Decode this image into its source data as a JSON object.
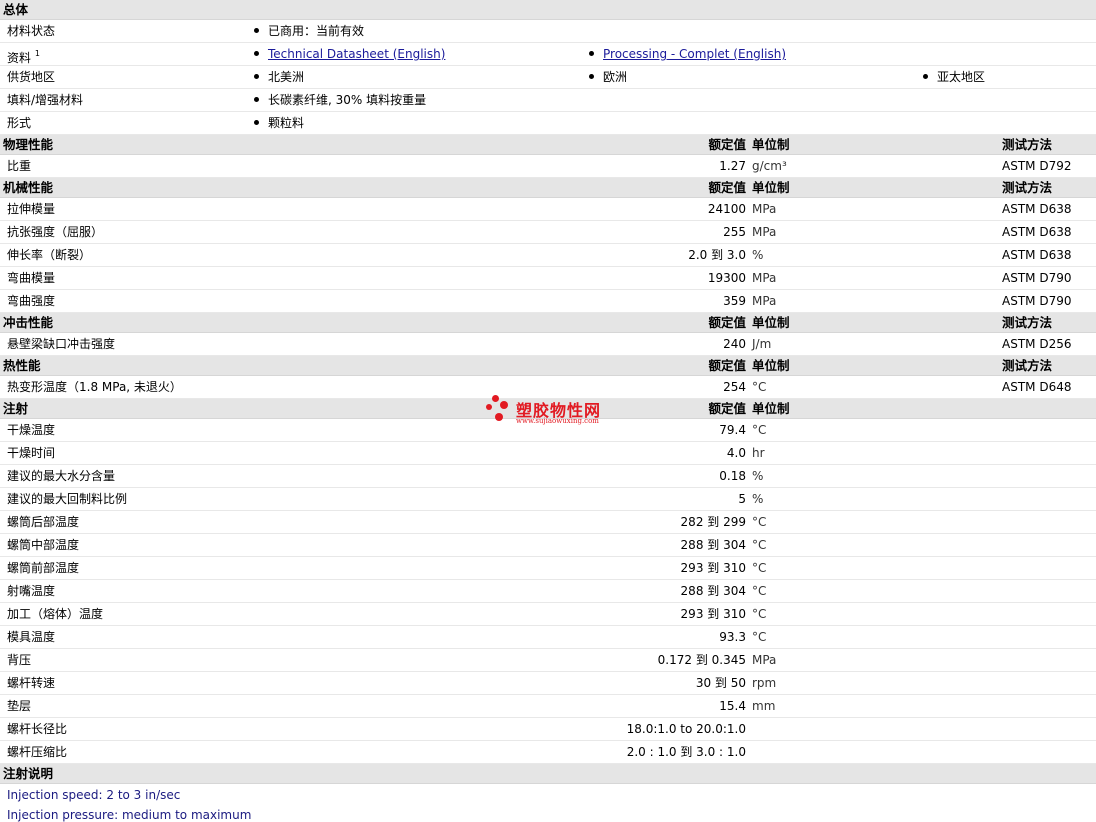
{
  "sections": {
    "general": "总体",
    "physical": "物理性能",
    "mechanical": "机械性能",
    "impact": "冲击性能",
    "thermal": "热性能",
    "injection": "注射",
    "injection_notes": "注射说明"
  },
  "headers": {
    "value": "额定值",
    "unit": "单位制",
    "test": "测试方法"
  },
  "general": {
    "status_label": "材料状态",
    "status_value": "已商用：当前有效",
    "docs_label": "资料",
    "docs_sup": "1",
    "doc1": "Technical Datasheet (English)",
    "doc2": "Processing - Complet (English)",
    "region_label": "供货地区",
    "region1": "北美洲",
    "region2": "欧洲",
    "region3": "亚太地区",
    "filler_label": "填料/增强材料",
    "filler_value": "长碳素纤维, 30% 填料按重量",
    "form_label": "形式",
    "form_value": "颗粒料"
  },
  "physical": [
    {
      "name": "比重",
      "value": "1.27",
      "unit": "g/cm³",
      "test": "ASTM D792"
    }
  ],
  "mechanical": [
    {
      "name": "拉伸模量",
      "value": "24100",
      "unit": "MPa",
      "test": "ASTM D638"
    },
    {
      "name": "抗张强度（屈服）",
      "value": "255",
      "unit": "MPa",
      "test": "ASTM D638"
    },
    {
      "name": "伸长率（断裂）",
      "value": "2.0 到  3.0",
      "unit": "%",
      "test": "ASTM D638"
    },
    {
      "name": "弯曲模量",
      "value": "19300",
      "unit": "MPa",
      "test": "ASTM D790"
    },
    {
      "name": "弯曲强度",
      "value": "359",
      "unit": "MPa",
      "test": "ASTM D790"
    }
  ],
  "impact": [
    {
      "name": "悬壁梁缺口冲击强度",
      "value": "240",
      "unit": "J/m",
      "test": "ASTM D256"
    }
  ],
  "thermal": [
    {
      "name": "热变形温度（1.8 MPa, 未退火）",
      "value": "254",
      "unit": "°C",
      "test": "ASTM D648"
    }
  ],
  "injection": [
    {
      "name": "干燥温度",
      "value": "79.4",
      "unit": "°C"
    },
    {
      "name": "干燥时间",
      "value": "4.0",
      "unit": "hr"
    },
    {
      "name": "建议的最大水分含量",
      "value": "0.18",
      "unit": "%"
    },
    {
      "name": "建议的最大回制料比例",
      "value": "5",
      "unit": "%"
    },
    {
      "name": "螺筒后部温度",
      "value": "282 到  299",
      "unit": "°C"
    },
    {
      "name": "螺筒中部温度",
      "value": "288 到  304",
      "unit": "°C"
    },
    {
      "name": "螺筒前部温度",
      "value": "293 到  310",
      "unit": "°C"
    },
    {
      "name": "射嘴温度",
      "value": "288 到  304",
      "unit": "°C"
    },
    {
      "name": "加工（熔体）温度",
      "value": "293 到  310",
      "unit": "°C"
    },
    {
      "name": "模具温度",
      "value": "93.3",
      "unit": "°C"
    },
    {
      "name": "背压",
      "value": "0.172 到  0.345",
      "unit": "MPa"
    },
    {
      "name": "螺杆转速",
      "value": "30 到  50",
      "unit": "rpm"
    },
    {
      "name": "垫层",
      "value": "15.4",
      "unit": "mm"
    },
    {
      "name": "螺杆长径比",
      "value": "18.0:1.0 to 20.0:1.0",
      "unit": ""
    },
    {
      "name": "螺杆压缩比",
      "value": "2.0 : 1.0 到  3.0 : 1.0",
      "unit": ""
    }
  ],
  "notes": [
    "Injection speed: 2 to 3 in/sec",
    "Injection pressure: medium to maximum"
  ],
  "watermark": {
    "title": "塑胶物性网",
    "url": "www.sujiaowuxing.com",
    "color": "#e21a22"
  }
}
